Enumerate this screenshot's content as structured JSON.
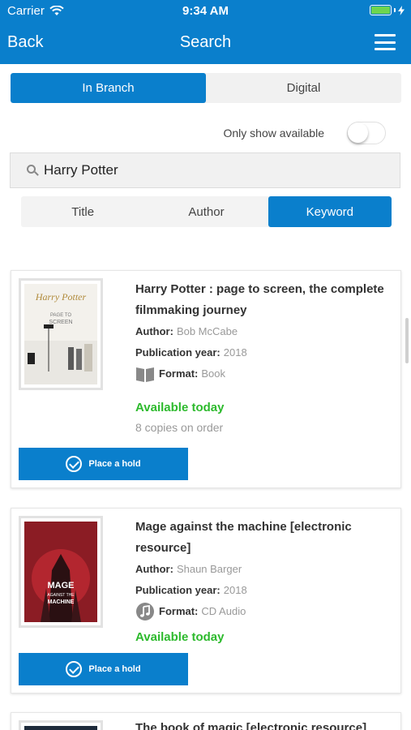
{
  "status": {
    "carrier": "Carrier",
    "time": "9:34 AM"
  },
  "nav": {
    "back": "Back",
    "title": "Search"
  },
  "location_tabs": [
    {
      "label": "In Branch",
      "active": true
    },
    {
      "label": "Digital",
      "active": false
    }
  ],
  "only_available": {
    "label": "Only show available",
    "on": false
  },
  "search": {
    "value": "Harry Potter"
  },
  "search_type_tabs": [
    {
      "label": "Title",
      "active": false
    },
    {
      "label": "Author",
      "active": false
    },
    {
      "label": "Keyword",
      "active": true
    }
  ],
  "results": [
    {
      "title": "Harry Potter : page to screen, the complete filmmaking journey",
      "author_label": "Author:",
      "author": "Bob McCabe",
      "year_label": "Publication year:",
      "year": "2018",
      "format_label": "Format:",
      "format": "Book",
      "format_icon": "book-icon",
      "availability": "Available today",
      "copies": "8 copies on order",
      "hold_label": "Place a hold",
      "cover_text": {
        "line1": "Harry Potter",
        "line2": "PAGE TO",
        "line3": "SCREEN"
      }
    },
    {
      "title": "Mage against the machine [electronic resource]",
      "author_label": "Author:",
      "author": "Shaun Barger",
      "year_label": "Publication year:",
      "year": "2018",
      "format_label": "Format:",
      "format": "CD Audio",
      "format_icon": "music-note-icon",
      "availability": "Available today",
      "hold_label": "Place a hold",
      "cover_text": {
        "line1": "MAGE",
        "line2": "AGAINST THE",
        "line3": "MACHINE"
      }
    },
    {
      "title": "The book of magic [electronic resource]"
    }
  ],
  "colors": {
    "primary": "#0a7fcc",
    "available": "#2dba2d",
    "muted": "#999999"
  }
}
